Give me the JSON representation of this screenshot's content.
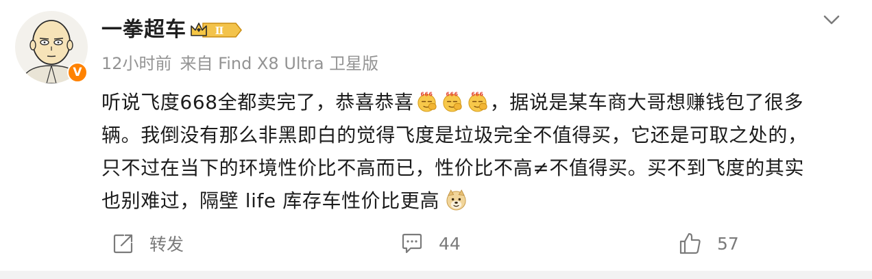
{
  "post": {
    "author": {
      "name": "一拳超车",
      "verified_badge": "V",
      "vip_level": "Ⅱ"
    },
    "meta": {
      "time": "12小时前",
      "source": "来自 Find X8 Ultra 卫星版"
    },
    "content": {
      "line1_a": "听说飞度668全都卖完了，恭喜恭喜",
      "line1_b": "，据说是某车商大哥想赚钱包了很多",
      "line2": "辆。我倒没有那么非黑即白的觉得飞度是垃圾完全不值得买，它还是可取之处的，",
      "line3": "只不过在当下的环境性价比不高而已，性价比不高≠不值得买。买不到飞度的其实",
      "line4": "也别难过，隔壁 life 库存车性价比更高",
      "emoji_666_text": "666",
      "emoji_names": [
        "666-emoji",
        "666-emoji",
        "666-emoji",
        "doge-emoji"
      ]
    },
    "actions": {
      "repost": {
        "label": "转发",
        "icon": "repost-icon"
      },
      "comment": {
        "count": "44",
        "icon": "comment-icon"
      },
      "like": {
        "count": "57",
        "icon": "thumbs-up-icon"
      }
    },
    "colors": {
      "text": "#1b1b1b",
      "meta": "#939393",
      "action": "#7a7a7a",
      "verified": "#ff8200",
      "vip_gold": "#f2b531"
    }
  }
}
